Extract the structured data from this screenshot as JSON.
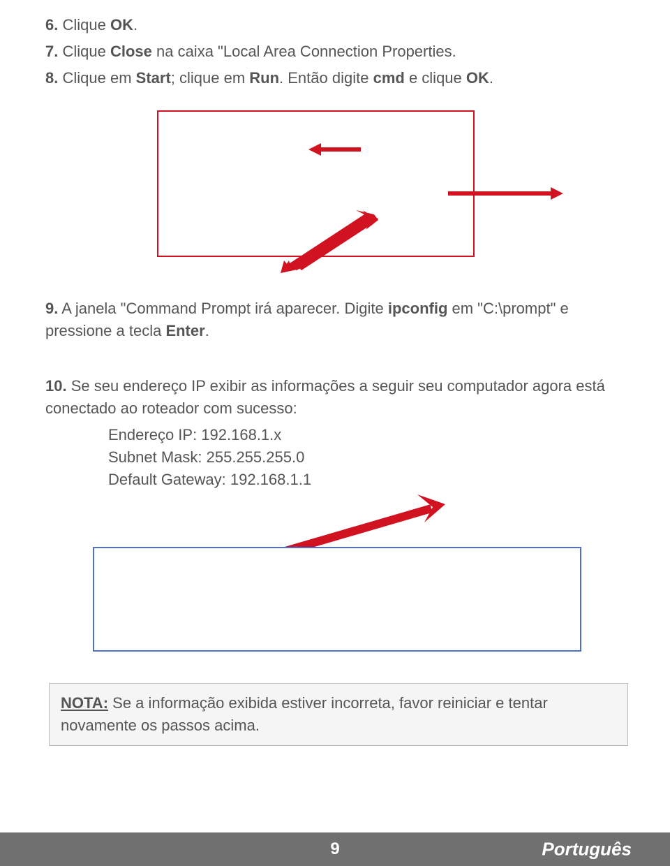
{
  "steps": {
    "s6": {
      "num": "6.",
      "a": " Clique ",
      "b": "OK",
      "c": "."
    },
    "s7": {
      "num": "7.",
      "a": " Clique ",
      "b": "Close",
      "c": " na caixa \"Local Area Connection Properties."
    },
    "s8": {
      "num": "8.",
      "a": " Clique em ",
      "b": "Start",
      "c": "; clique em ",
      "d": "Run",
      "e": ". Então digite ",
      "f": "cmd",
      "g": " e clique ",
      "h": "OK",
      "i": "."
    },
    "s9": {
      "num": "9.",
      "a": " A janela \"Command Prompt irá aparecer. Digite ",
      "b": "ipconfig",
      "c": " em \"C:\\prompt\" e pressione a tecla ",
      "d": "Enter",
      "e": "."
    },
    "s10": {
      "num": "10.",
      "a": " Se seu endereço IP exibir as informações a seguir seu computador agora está conectado ao roteador com sucesso:",
      "ip_label": "Endereço IP: 192.168.1.x",
      "mask_label": "Subnet Mask: 255.255.255.0",
      "gw_label": "Default Gateway: 192.168.1.1"
    }
  },
  "note": {
    "label": "NOTA:",
    "text": " Se a informação exibida estiver incorreta, favor reiniciar e tentar novamente os passos acima."
  },
  "footer": {
    "page": "9",
    "language": "Português"
  },
  "colors": {
    "arrow_red": "#d01221",
    "box_blue": "#5070c8",
    "footer_gray": "#707070"
  }
}
